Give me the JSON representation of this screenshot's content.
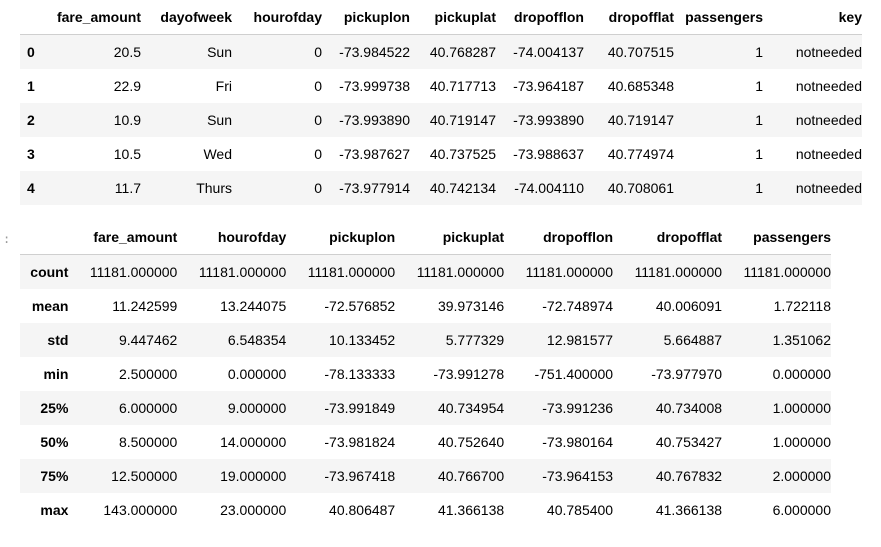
{
  "table1": {
    "columns": [
      "",
      "fare_amount",
      "dayofweek",
      "hourofday",
      "pickuplon",
      "pickuplat",
      "dropofflon",
      "dropofflat",
      "passengers",
      "key"
    ],
    "rows": [
      [
        "0",
        "20.5",
        "Sun",
        "0",
        "-73.984522",
        "40.768287",
        "-74.004137",
        "40.707515",
        "1",
        "notneeded"
      ],
      [
        "1",
        "22.9",
        "Fri",
        "0",
        "-73.999738",
        "40.717713",
        "-73.964187",
        "40.685348",
        "1",
        "notneeded"
      ],
      [
        "2",
        "10.9",
        "Sun",
        "0",
        "-73.993890",
        "40.719147",
        "-73.993890",
        "40.719147",
        "1",
        "notneeded"
      ],
      [
        "3",
        "10.5",
        "Wed",
        "0",
        "-73.987627",
        "40.737525",
        "-73.988637",
        "40.774974",
        "1",
        "notneeded"
      ],
      [
        "4",
        "11.7",
        "Thurs",
        "0",
        "-73.977914",
        "40.742134",
        "-74.004110",
        "40.708061",
        "1",
        "notneeded"
      ]
    ]
  },
  "cell_marker": ":",
  "table2": {
    "columns": [
      "",
      "fare_amount",
      "hourofday",
      "pickuplon",
      "pickuplat",
      "dropofflon",
      "dropofflat",
      "passengers"
    ],
    "rows": [
      [
        "count",
        "11181.000000",
        "11181.000000",
        "11181.000000",
        "11181.000000",
        "11181.000000",
        "11181.000000",
        "11181.000000"
      ],
      [
        "mean",
        "11.242599",
        "13.244075",
        "-72.576852",
        "39.973146",
        "-72.748974",
        "40.006091",
        "1.722118"
      ],
      [
        "std",
        "9.447462",
        "6.548354",
        "10.133452",
        "5.777329",
        "12.981577",
        "5.664887",
        "1.351062"
      ],
      [
        "min",
        "2.500000",
        "0.000000",
        "-78.133333",
        "-73.991278",
        "-751.400000",
        "-73.977970",
        "0.000000"
      ],
      [
        "25%",
        "6.000000",
        "9.000000",
        "-73.991849",
        "40.734954",
        "-73.991236",
        "40.734008",
        "1.000000"
      ],
      [
        "50%",
        "8.500000",
        "14.000000",
        "-73.981824",
        "40.752640",
        "-73.980164",
        "40.753427",
        "1.000000"
      ],
      [
        "75%",
        "12.500000",
        "19.000000",
        "-73.967418",
        "40.766700",
        "-73.964153",
        "40.767832",
        "2.000000"
      ],
      [
        "max",
        "143.000000",
        "23.000000",
        "40.806487",
        "41.366138",
        "40.785400",
        "41.366138",
        "6.000000"
      ]
    ]
  }
}
